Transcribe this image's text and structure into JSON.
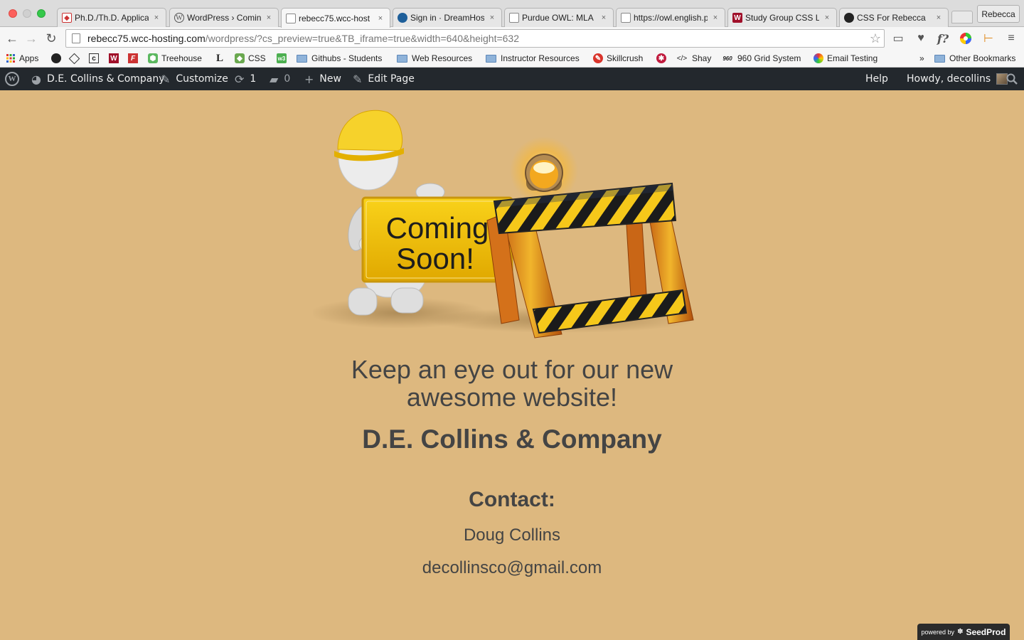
{
  "browser": {
    "tabs": [
      {
        "title": "Ph.D./Th.D. Applica",
        "favicon": "document-icon",
        "active": false
      },
      {
        "title": "WordPress › Coming",
        "favicon": "wordpress-icon",
        "active": false
      },
      {
        "title": "rebecc75.wcc-host",
        "favicon": "page-icon",
        "active": true
      },
      {
        "title": "Sign in · DreamHost",
        "favicon": "dreamhost-icon",
        "active": false
      },
      {
        "title": "Purdue OWL: MLA F",
        "favicon": "page-icon",
        "active": false
      },
      {
        "title": "https://owl.english.p",
        "favicon": "page-icon",
        "active": false
      },
      {
        "title": "Study Group CSS La",
        "favicon": "w-icon",
        "active": false
      },
      {
        "title": "CSS For Rebecca",
        "favicon": "github-icon",
        "active": false
      }
    ],
    "close_glyph": "×",
    "profile_name": "Rebecca",
    "url_host": "rebecc75.wcc-hosting.com",
    "url_path": "/wordpress/?cs_preview=true&TB_iframe=true&width=640&height=632",
    "bookmarks": [
      {
        "label": "Apps",
        "icon": "apps-grid-icon"
      },
      {
        "label": "",
        "icon": "github-icon"
      },
      {
        "label": "",
        "icon": "codepen-icon"
      },
      {
        "label": "",
        "icon": "cl-icon"
      },
      {
        "label": "",
        "icon": "w-icon"
      },
      {
        "label": "",
        "icon": "fiddle-icon"
      },
      {
        "label": "Treehouse",
        "icon": "treehouse-icon"
      },
      {
        "label": "",
        "icon": "l-icon"
      },
      {
        "label": "CSS",
        "icon": "css-icon"
      },
      {
        "label": "",
        "icon": "w3-icon"
      },
      {
        "label": "Githubs - Students",
        "icon": "folder-icon"
      },
      {
        "label": "Web Resources",
        "icon": "folder-icon"
      },
      {
        "label": "Instructor Resources",
        "icon": "folder-icon"
      },
      {
        "label": "Skillcrush",
        "icon": "skillcrush-icon"
      },
      {
        "label": "",
        "icon": "bug-icon"
      },
      {
        "label": "Shay",
        "icon": "code-icon"
      },
      {
        "label": "960 Grid System",
        "icon": "grid960-icon"
      },
      {
        "label": "Email Testing",
        "icon": "email-testing-icon"
      }
    ],
    "overflow_chevron": "»",
    "other_bookmarks": "Other Bookmarks"
  },
  "adminbar": {
    "site_name": "D.E. Collins & Company",
    "customize": "Customize",
    "updates_count": "1",
    "comments_count": "0",
    "new": "New",
    "edit_page": "Edit Page",
    "help": "Help",
    "howdy": "Howdy, decollins"
  },
  "page": {
    "sign_line1": "Coming",
    "sign_line2": "Soon!",
    "tagline_line1": "Keep an eye out for our new",
    "tagline_line2": "awesome website!",
    "company": "D.E. Collins & Company",
    "contact_heading": "Contact:",
    "contact_name": "Doug Collins",
    "contact_email": "decollinsco@gmail.com",
    "powered_by": "powered by",
    "powered_brand": "SeedProd"
  },
  "colors": {
    "page_background": "#ddb87f",
    "adminbar_background": "#23282d",
    "text": "#444444"
  }
}
